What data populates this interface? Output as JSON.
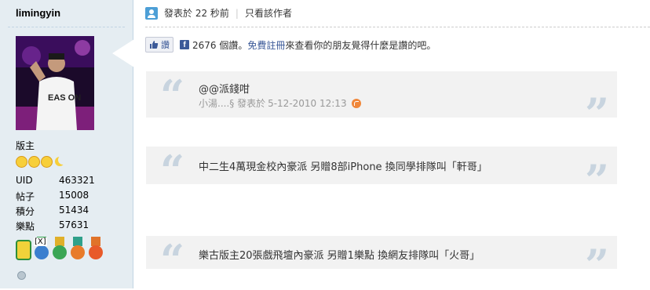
{
  "author": {
    "name": "limingyin",
    "role": "版主",
    "stats": [
      {
        "label": "UID",
        "value": "463321"
      },
      {
        "label": "帖子",
        "value": "15008"
      },
      {
        "label": "積分",
        "value": "51434"
      },
      {
        "label": "樂點",
        "value": "57631"
      }
    ],
    "medal_tag": "[X]",
    "avatar_shirt_text": "EAS ON"
  },
  "post": {
    "posted": "發表於 22 秒前",
    "only_author": "只看該作者",
    "like_button": "讚",
    "like_count": "2676 個讚。",
    "signup_link": "免費註冊",
    "like_suffix": "來查看你的朋友覺得什麼是讚的吧。",
    "quotes": [
      {
        "line1": "@@派錢咁",
        "line2_user": "小湯....§ 發表於",
        "line2_date": "5-12-2010 12:13"
      },
      {
        "line1": "中二生4萬現金校內豪派 另贈8部iPhone 換同學排隊叫「軒哥」"
      },
      {
        "line1": "樂古版主20張戲飛壇內豪派 另贈1樂點 換網友排隊叫「火哥」"
      }
    ]
  },
  "colors": {
    "sidebar": "#e5edf2",
    "quote_bg": "#f2f2f2",
    "link": "#3b5998"
  }
}
